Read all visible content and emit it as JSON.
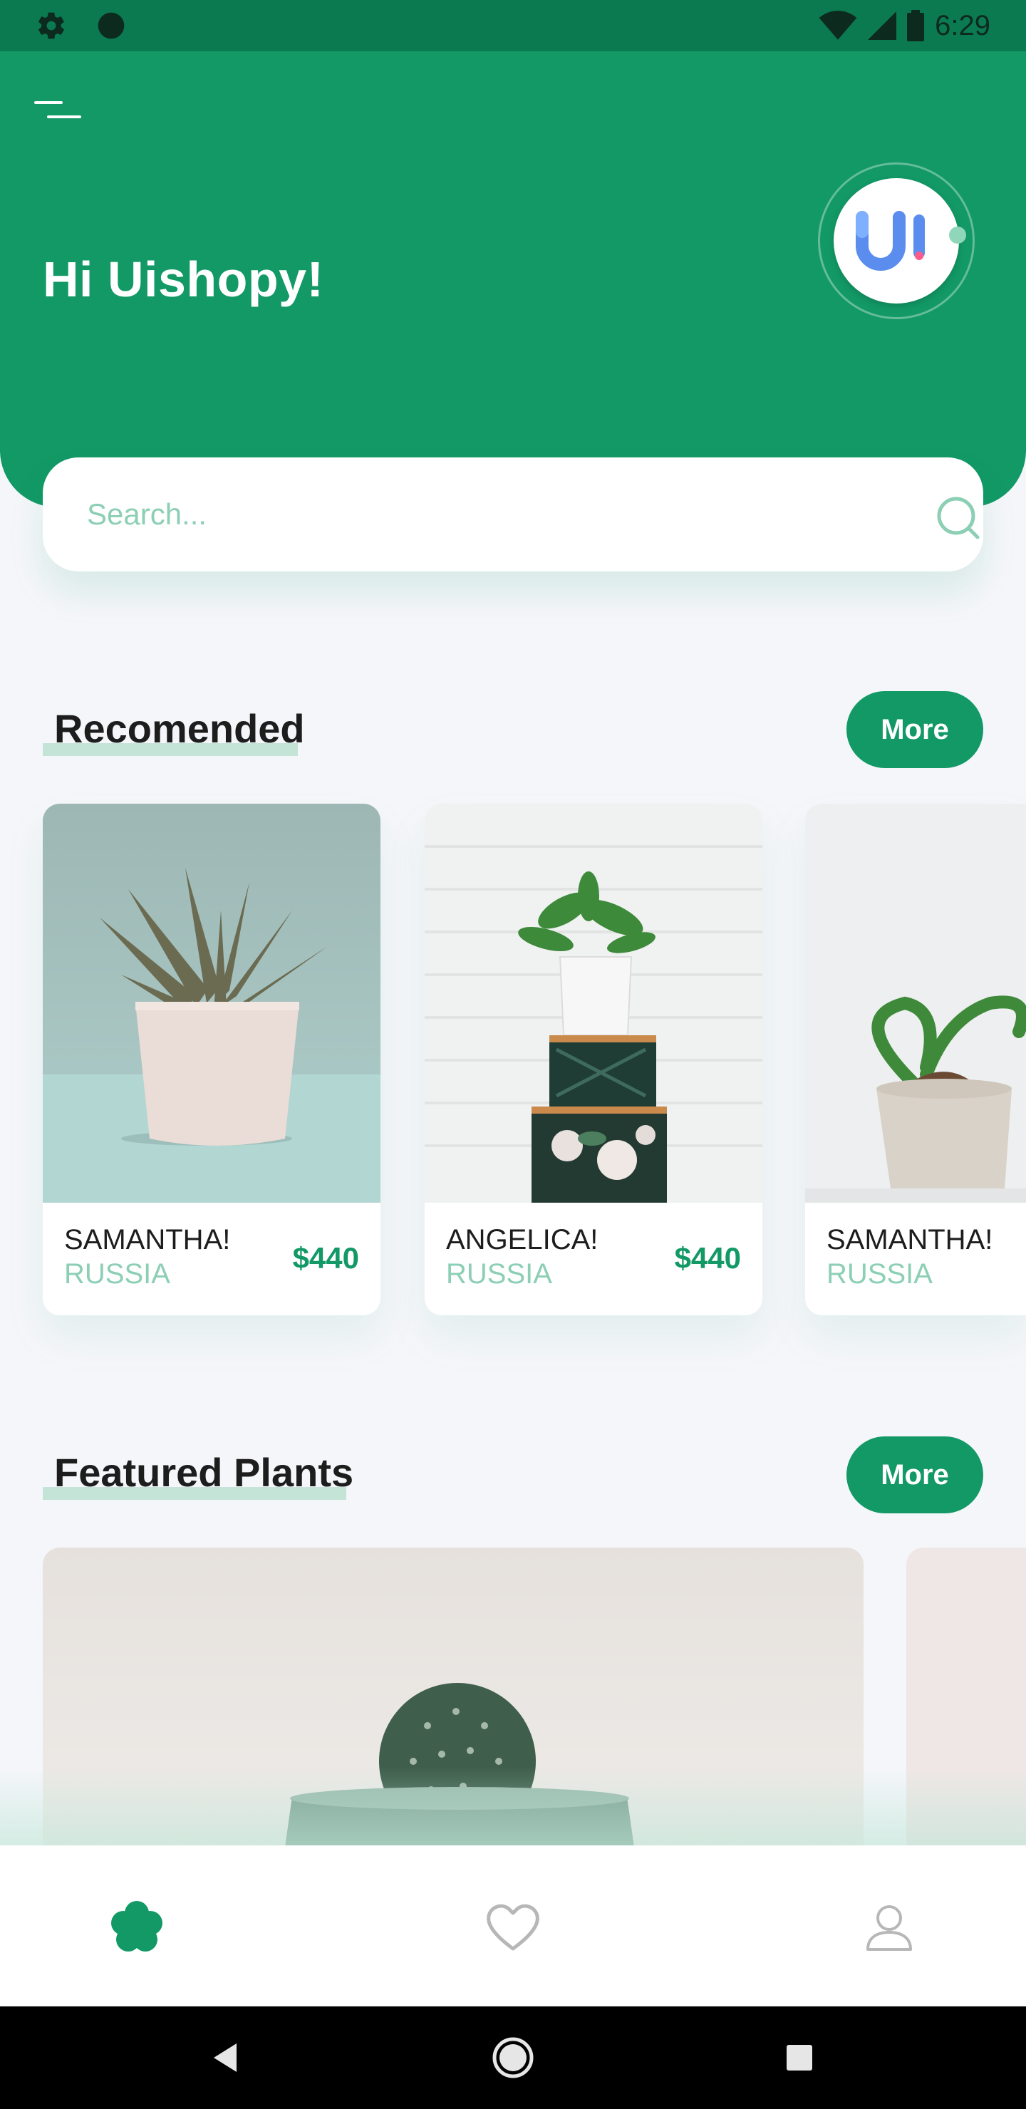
{
  "status_bar": {
    "time": "6:29",
    "icons": [
      "settings-icon",
      "circle-icon",
      "wifi-icon",
      "signal-icon",
      "battery-icon"
    ]
  },
  "header": {
    "greeting": "Hi Uishopy!",
    "avatar_text": "UI",
    "colors": {
      "primary": "#129966",
      "accent_light": "#8ccfb5"
    }
  },
  "search": {
    "placeholder": "Search..."
  },
  "recommended": {
    "title": "Recomended",
    "more_label": "More",
    "items": [
      {
        "name": "SAMANTHA!",
        "country": "RUSSIA",
        "price": "$440"
      },
      {
        "name": "ANGELICA!",
        "country": "RUSSIA",
        "price": "$440"
      },
      {
        "name": "SAMANTHA!",
        "country": "RUSSIA",
        "price": ""
      }
    ]
  },
  "featured": {
    "title": "Featured Plants",
    "more_label": "More"
  },
  "bottom_nav": {
    "items": [
      "flower-icon",
      "heart-icon",
      "user-icon"
    ],
    "active": "flower-icon"
  },
  "system_nav": [
    "back-icon",
    "home-icon",
    "recents-icon"
  ]
}
